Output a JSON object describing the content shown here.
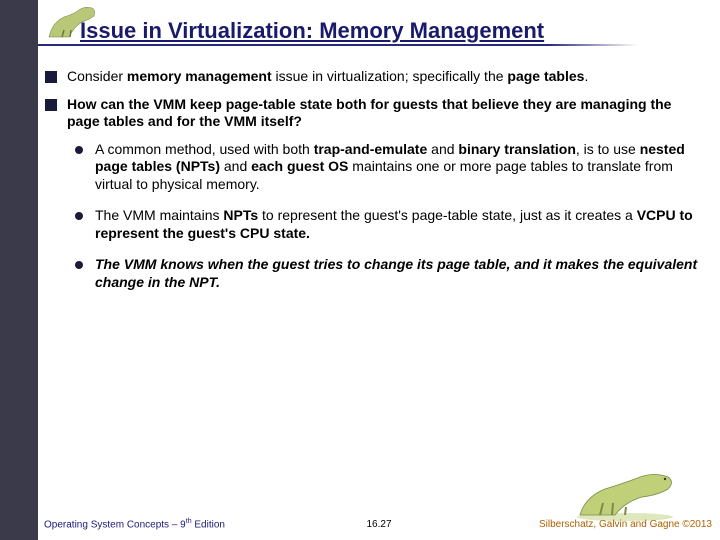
{
  "slide": {
    "title": "Issue in Virtualization: Memory Management",
    "bullets": [
      {
        "html": "Consider <b>memory management</b> issue in virtualization; specifically the <b>page tables</b>."
      },
      {
        "html": "<b>How can the VMM keep page-table state both for guests that believe they are managing the page tables and for the VMM itself?</b>",
        "sub": [
          {
            "html": "A common method, used with both <b>trap-and-emulate</b> and <b>binary translation</b>, is to use <b>nested page tables (NPTs)</b> and <b>each guest OS</b> maintains one or more page tables to translate from virtual to physical memory."
          },
          {
            "html": " The VMM maintains <b>NPTs</b> to represent the guest's page-table state, just as it creates a <b>VCPU to represent the guest's CPU state.</b>"
          },
          {
            "html": "<b><i>The VMM knows when the guest tries to change its page table, and it makes the equivalent change in the NPT.</i></b>"
          }
        ]
      }
    ]
  },
  "footer": {
    "left_html": "Operating System Concepts – 9<sup>th</sup> Edition",
    "center": "16.27",
    "right_html": "Silberschatz, Galvin and Gagne ©2013"
  }
}
